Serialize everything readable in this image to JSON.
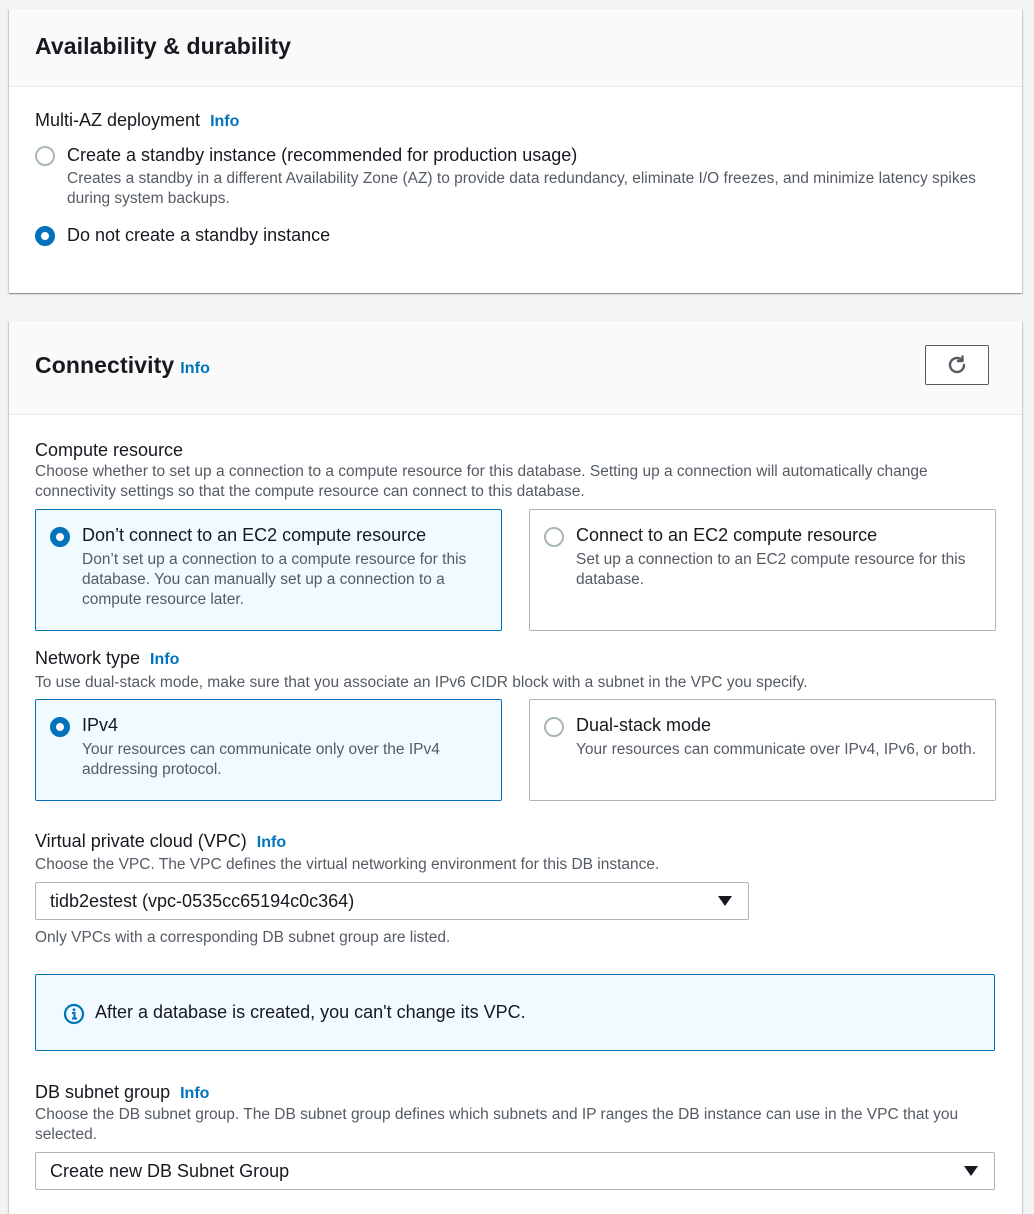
{
  "availability": {
    "title": "Availability & durability",
    "multi_az_label": "Multi-AZ deployment",
    "info": "Info",
    "options": [
      {
        "label": "Create a standby instance (recommended for production usage)",
        "description": "Creates a standby in a different Availability Zone (AZ) to provide data redundancy, eliminate I/O freezes, and minimize latency spikes during system backups.",
        "selected": false
      },
      {
        "label": "Do not create a standby instance",
        "selected": true
      }
    ]
  },
  "connectivity": {
    "title": "Connectivity",
    "info": "Info",
    "refresh_icon": "refresh-icon",
    "compute": {
      "label": "Compute resource",
      "description": "Choose whether to set up a connection to a compute resource for this database. Setting up a connection will automatically change connectivity settings so that the compute resource can connect to this database.",
      "options": [
        {
          "label": "Don’t connect to an EC2 compute resource",
          "description": "Don’t set up a connection to a compute resource for this database. You can manually set up a connection to a compute resource later.",
          "selected": true
        },
        {
          "label": "Connect to an EC2 compute resource",
          "description": "Set up a connection to an EC2 compute resource for this database.",
          "selected": false
        }
      ]
    },
    "network": {
      "label": "Network type",
      "info": "Info",
      "description": "To use dual-stack mode, make sure that you associate an IPv6 CIDR block with a subnet in the VPC you specify.",
      "options": [
        {
          "label": "IPv4",
          "description": "Your resources can communicate only over the IPv4 addressing protocol.",
          "selected": true
        },
        {
          "label": "Dual-stack mode",
          "description": "Your resources can communicate over IPv4, IPv6, or both.",
          "selected": false
        }
      ]
    },
    "vpc": {
      "label": "Virtual private cloud (VPC)",
      "info": "Info",
      "description": "Choose the VPC. The VPC defines the virtual networking environment for this DB instance.",
      "selected": "tidb2estest (vpc-0535cc65194c0c364)",
      "hint": "Only VPCs with a corresponding DB subnet group are listed."
    },
    "alert": {
      "icon": "info-circle-icon",
      "text": "After a database is created, you can't change its VPC."
    },
    "subnet": {
      "label": "DB subnet group",
      "info": "Info",
      "description": "Choose the DB subnet group. The DB subnet group defines which subnets and IP ranges the DB instance can use in the VPC that you selected.",
      "selected": "Create new DB Subnet Group"
    }
  },
  "colors": {
    "accent": "#0073bb",
    "selected_bg": "#f1faff",
    "text": "#16191f",
    "muted": "#545b64"
  }
}
